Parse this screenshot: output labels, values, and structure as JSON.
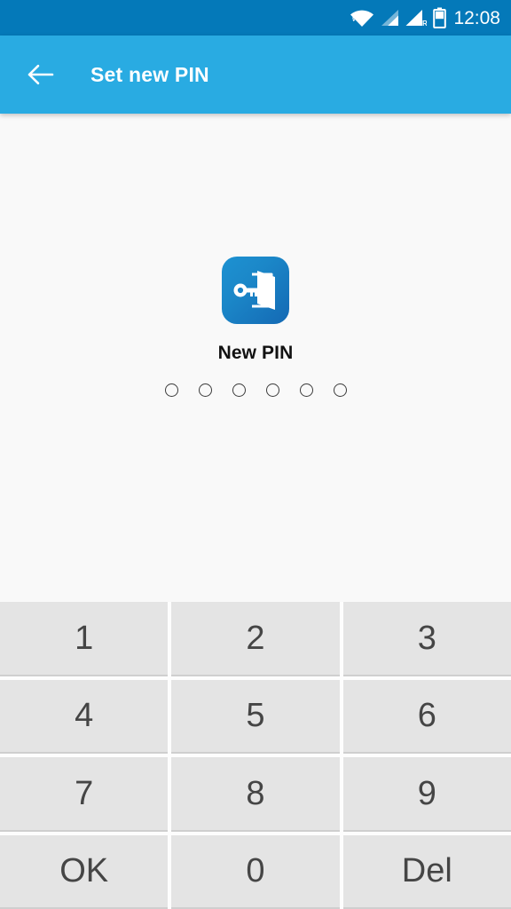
{
  "status_bar": {
    "time": "12:08",
    "icons": [
      {
        "name": "wifi-icon",
        "label": "wifi"
      },
      {
        "name": "signal-icon",
        "label": "signal"
      },
      {
        "name": "signal-roaming-icon",
        "label": "signal roaming"
      },
      {
        "name": "battery-icon",
        "label": "battery"
      }
    ],
    "roaming_badge": "R",
    "background_color": "#0479b9"
  },
  "toolbar": {
    "back_label": "Back",
    "title": "Set new PIN",
    "background_color": "#29abe2",
    "text_color": "#ffffff"
  },
  "content": {
    "app_icon_name": "key-door-icon",
    "pin_label": "New PIN",
    "pin_length": 6,
    "pin_entered": 0,
    "background_color": "#f9f9f9"
  },
  "keypad": {
    "keys": [
      {
        "label": "1",
        "name": "key-1"
      },
      {
        "label": "2",
        "name": "key-2"
      },
      {
        "label": "3",
        "name": "key-3"
      },
      {
        "label": "4",
        "name": "key-4"
      },
      {
        "label": "5",
        "name": "key-5"
      },
      {
        "label": "6",
        "name": "key-6"
      },
      {
        "label": "7",
        "name": "key-7"
      },
      {
        "label": "8",
        "name": "key-8"
      },
      {
        "label": "9",
        "name": "key-9"
      },
      {
        "label": "OK",
        "name": "key-ok"
      },
      {
        "label": "0",
        "name": "key-0"
      },
      {
        "label": "Del",
        "name": "key-del"
      }
    ],
    "key_color": "#e4e4e4",
    "key_text_color": "#454545"
  }
}
